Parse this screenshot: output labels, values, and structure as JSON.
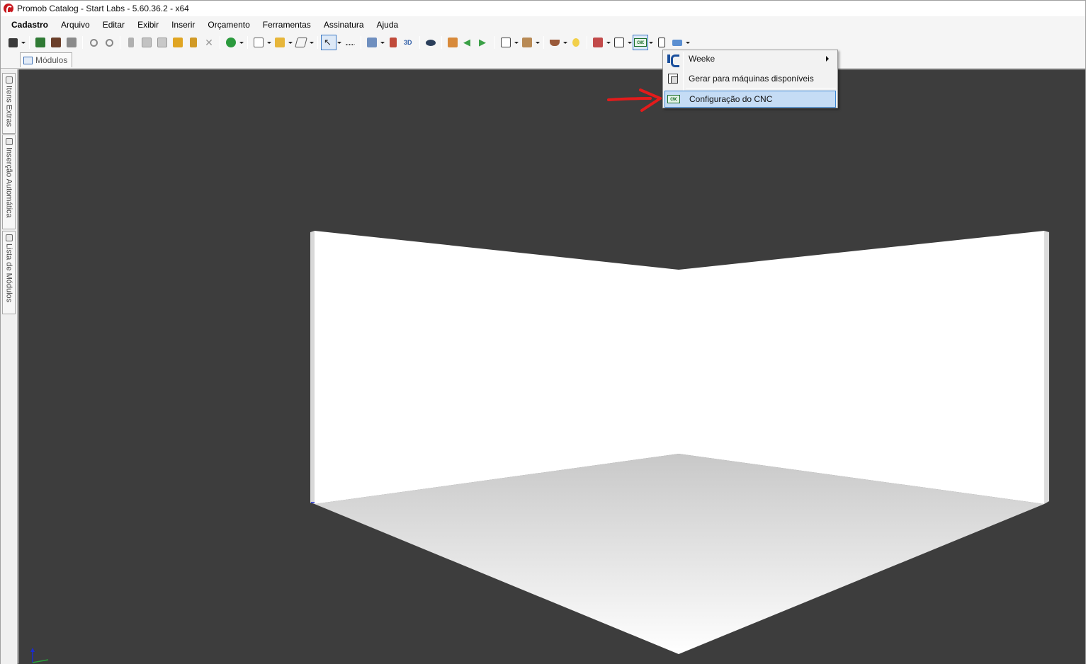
{
  "window": {
    "title": "Promob Catalog - Start Labs - 5.60.36.2 - x64"
  },
  "menubar": {
    "items": [
      "Cadastro",
      "Arquivo",
      "Editar",
      "Exibir",
      "Inserir",
      "Orçamento",
      "Ferramentas",
      "Assinatura",
      "Ajuda"
    ]
  },
  "toolbar": {
    "icons": [
      "save-icon",
      "print-icon",
      "print-preview-icon",
      "printer-icon",
      "undo-icon",
      "redo-icon",
      "cut-icon",
      "copy-icon",
      "paste-icon",
      "paint-brush-icon",
      "format-paint-icon",
      "delete-icon",
      "budget-icon",
      "modules-icon",
      "group-icon",
      "shape-icon",
      "select-arrow-icon",
      "measure-icon",
      "layers-icon",
      "elevation-icon",
      "3d-icon",
      "eye-icon",
      "render-icon",
      "arrow-left-icon",
      "arrow-right-icon",
      "view-cube-icon",
      "box-icon",
      "cup-icon",
      "light-bulb-icon",
      "report-icon",
      "plan-icon",
      "cnc-icon",
      "export-icon",
      "chart-icon"
    ],
    "cnc_label": "CNC"
  },
  "document_tabs": [
    {
      "label": "Módulos"
    }
  ],
  "side_panels": [
    {
      "label": "Itens Extras",
      "icon": "paperclip-icon"
    },
    {
      "label": "Inserção Automática",
      "icon": "wrench-icon"
    },
    {
      "label": "Lista de Módulos",
      "icon": "list-icon"
    }
  ],
  "popup_menu": {
    "items": [
      {
        "label": "Weeke",
        "icon": "weeke-logo-icon",
        "has_submenu": true
      },
      {
        "label": "Gerar para máquinas disponíveis",
        "icon": "generate-machines-icon",
        "has_submenu": false
      },
      {
        "label": "Configuração do CNC",
        "icon": "cnc-config-icon",
        "has_submenu": false,
        "highlighted": true
      }
    ]
  },
  "viewport": {
    "background": "#3d3d3d",
    "wall_color": "#ffffff",
    "floor_gradient": [
      "#c8c8c8",
      "#ffffff"
    ]
  },
  "annotation": {
    "color": "#e41b1b",
    "icon": "red-arrow-icon"
  }
}
